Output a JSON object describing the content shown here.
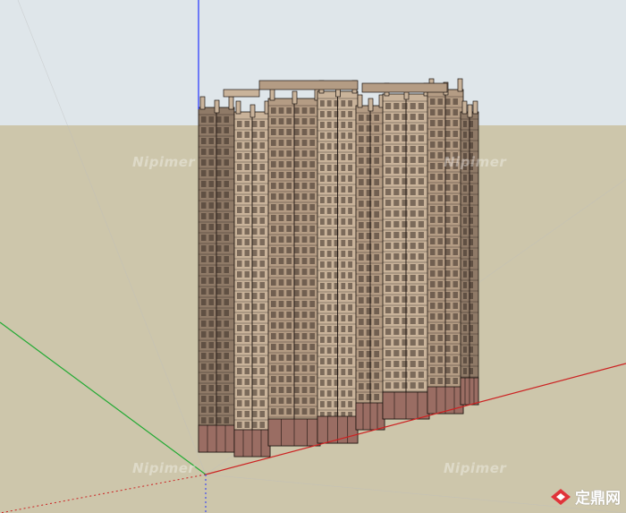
{
  "scene": {
    "sky_color": "#dfe6ea",
    "ground_color": "#cdc6ab",
    "axes": {
      "blue": "#2233ff",
      "red": "#cc2222",
      "green": "#22aa33"
    },
    "building": {
      "facade_light": "#c9b39a",
      "facade_mid": "#b49c84",
      "facade_shadow": "#8f7a67",
      "line_color": "#1c1410",
      "base_color": "#9a6d63"
    }
  },
  "watermarks": [
    "Nipimer",
    "Nipimer",
    "Nipimer",
    "Nipimer"
  ],
  "logo": {
    "icon": "zhulong-logo-icon",
    "text": "定鼎网",
    "accent": "#e0343a"
  }
}
